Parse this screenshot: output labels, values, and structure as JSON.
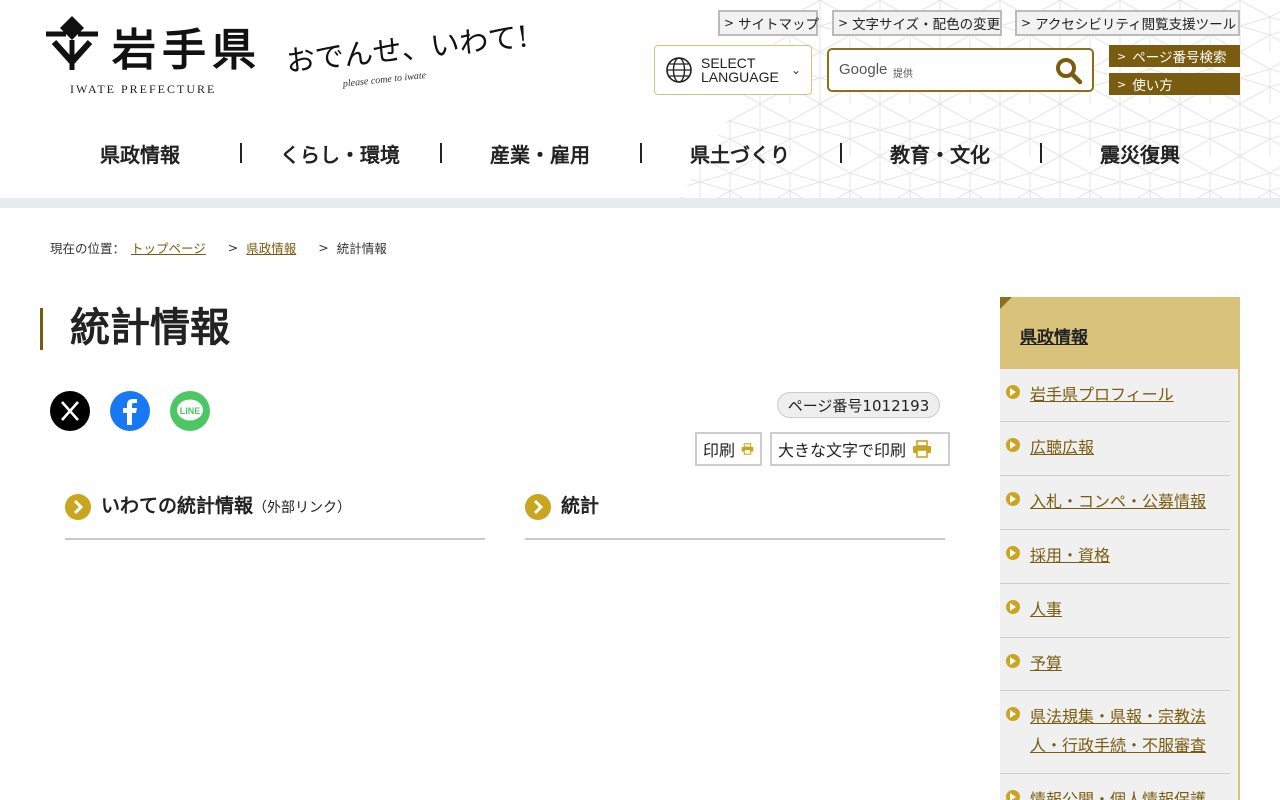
{
  "header": {
    "logo_name": "岩手県",
    "logo_en": "IWATE PREFECTURE",
    "catch_main": "おでんせ、いわて!",
    "catch_sub": "please come to iwate",
    "util_links": [
      "サイトマップ",
      "文字サイズ・配色の変更",
      "アクセシビリティ閲覧支援ツール"
    ],
    "lang_line1": "SELECT",
    "lang_line2": "LANGUAGE",
    "search_google": "Google",
    "search_provided": "提供",
    "page_number_search": "ページ番号検索",
    "howto": "使い方",
    "nav": [
      "県政情報",
      "くらし・環境",
      "産業・雇用",
      "県土づくり",
      "教育・文化",
      "震災復興"
    ]
  },
  "breadcrumb": {
    "label": "現在の位置：",
    "items": [
      "トップページ",
      "県政情報"
    ],
    "current": "統計情報"
  },
  "main": {
    "title": "統計情報",
    "share_icons": [
      "x-icon",
      "facebook-icon",
      "line-icon"
    ],
    "share_line_text": "LINE",
    "page_number": "ページ番号1012193",
    "print": "印刷",
    "print_large": "大きな文字で印刷",
    "links": [
      {
        "label": "いわての統計情報",
        "suffix": "（外部リンク）"
      },
      {
        "label": "統計",
        "suffix": ""
      }
    ]
  },
  "side": {
    "title": "県政情報",
    "items": [
      "岩手県プロフィール",
      "広聴広報",
      "入札・コンペ・公募情報",
      "採用・資格",
      "人事",
      "予算",
      "県法規集・県報・宗教法人・行政手続・不服審査",
      "情報公開・個人情報保護"
    ]
  },
  "colors": {
    "brand_brown": "#7a5c10",
    "accent_gold": "#c9a520",
    "side_head": "#d8c27c",
    "facebook": "#1877f2",
    "line": "#4cc764"
  }
}
